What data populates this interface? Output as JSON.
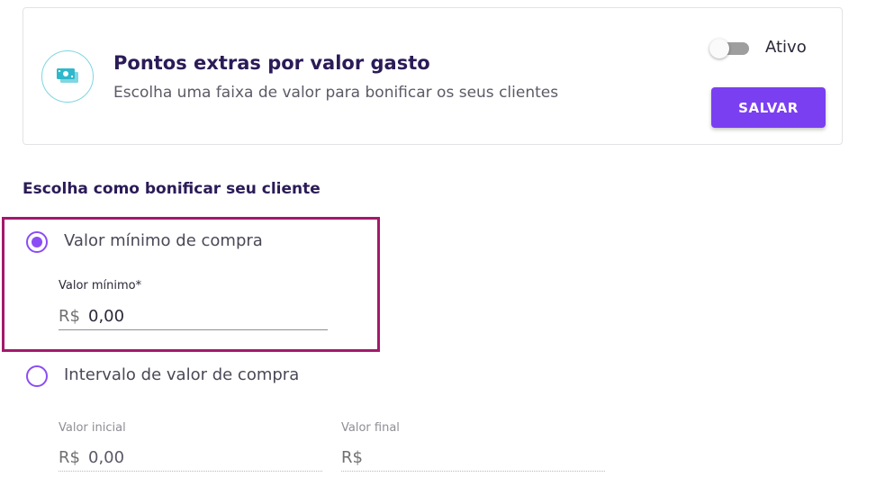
{
  "card": {
    "icon": "money-bills-icon",
    "title": "Pontos extras por valor gasto",
    "subtitle": "Escolha uma faixa de valor para bonificar os seus clientes",
    "toggle_label": "Ativo",
    "toggle_on": false,
    "save_label": "SALVAR"
  },
  "colors": {
    "accent": "#7b3ff2",
    "title": "#2b1b57",
    "highlight": "#a3196b",
    "icon_ring": "#7fd6e2"
  },
  "section": {
    "title": "Escolha como bonificar seu cliente"
  },
  "options": [
    {
      "label": "Valor mínimo de compra",
      "selected": true,
      "fields": [
        {
          "label": "Valor mínimo*",
          "prefix": "R$",
          "value": "0,00"
        }
      ]
    },
    {
      "label": "Intervalo de valor de compra",
      "selected": false,
      "fields": [
        {
          "label": "Valor inicial",
          "prefix": "R$",
          "value": "0,00"
        },
        {
          "label": "Valor final",
          "prefix": "R$",
          "value": ""
        }
      ]
    }
  ]
}
